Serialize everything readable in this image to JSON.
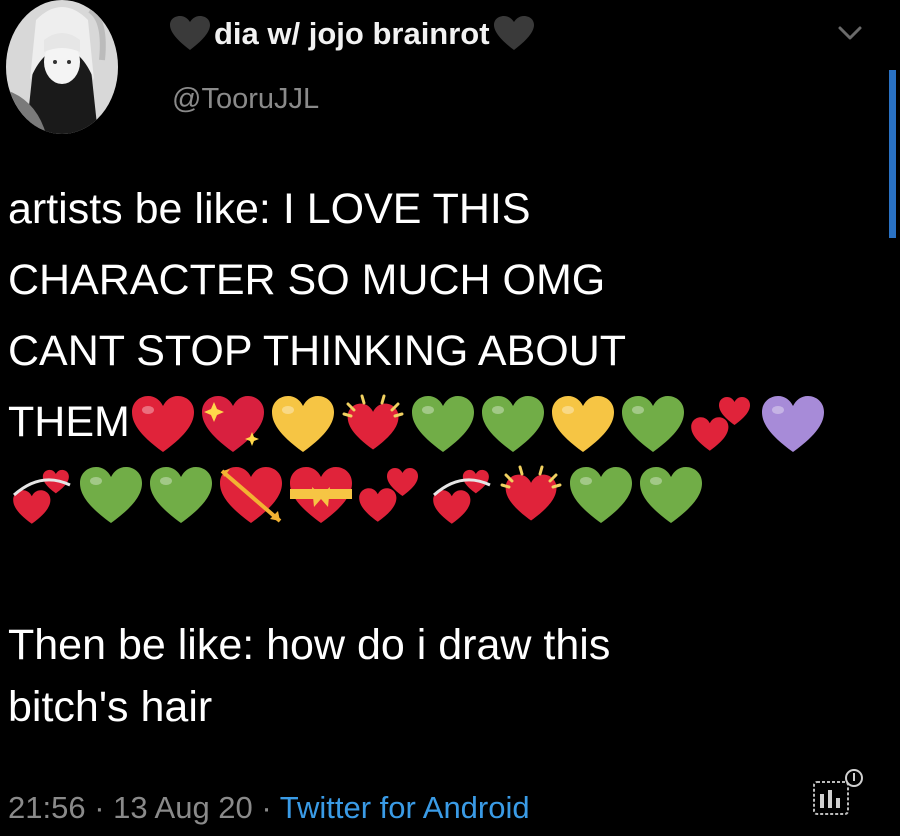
{
  "author": {
    "display_name": "dia w/ jojo brainrot",
    "handle": "@TooruJJL",
    "avatar_icon": "anime-girl-avatar-icon"
  },
  "tweet": {
    "line1": "artists be like: I LOVE THIS",
    "line2": "CHARACTER SO MUCH OMG",
    "line3": "CANT STOP THINKING ABOUT",
    "line4_text": "THEM",
    "emoji_row1": [
      "red-heart",
      "sparkling-heart",
      "yellow-heart",
      "beating-heart",
      "green-heart",
      "green-heart",
      "yellow-heart",
      "green-heart",
      "two-hearts",
      "purple-heart"
    ],
    "emoji_row2": [
      "revolving-hearts",
      "green-heart",
      "green-heart",
      "heart-with-arrow",
      "heart-with-ribbon",
      "two-hearts",
      "revolving-hearts",
      "beating-heart",
      "green-heart",
      "green-heart"
    ],
    "second_line1": "Then be like: how do i draw this",
    "second_line2": "bitch's hair"
  },
  "meta": {
    "time": "21:56",
    "separator1": " · ",
    "date": "13 Aug 20",
    "separator2": " · ",
    "source": "Twitter for Android"
  },
  "colors": {
    "background": "#000000",
    "text": "#ffffff",
    "muted": "#8a8a8a",
    "link": "#3a9be6",
    "red": "#e0233a",
    "green": "#71ad47",
    "yellow": "#f6c544",
    "purple": "#a78bd8"
  }
}
